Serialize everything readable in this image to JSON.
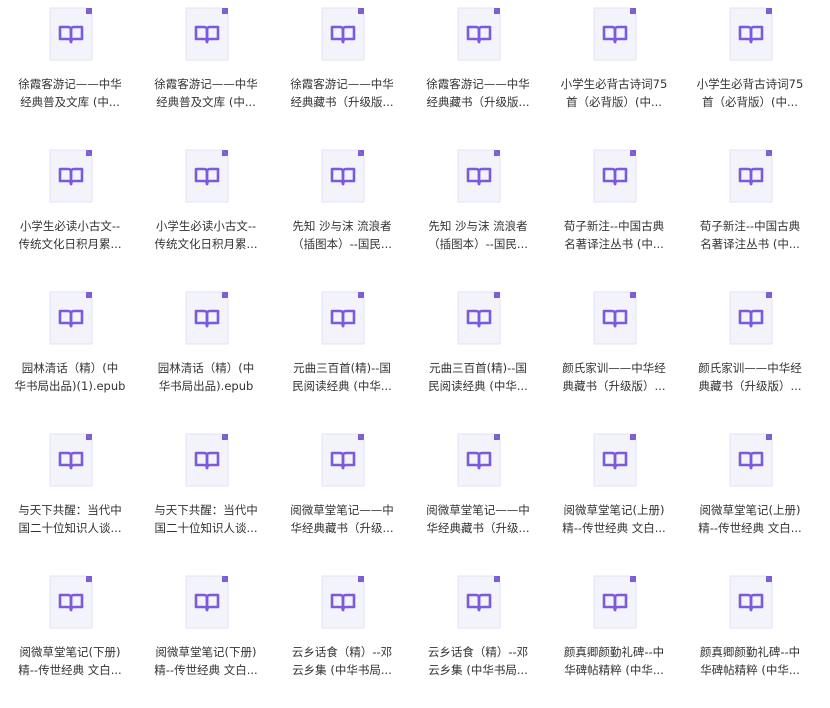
{
  "colors": {
    "page_bg": "#f3f3fb",
    "page_fold": "#ffffff",
    "accent": "#7b5bdc",
    "text": "#333333"
  },
  "icon_name": "book-file-icon",
  "files": [
    {
      "name": "徐霞客游记——中华\n经典普及文库 (中..."
    },
    {
      "name": "徐霞客游记——中华\n经典普及文库 (中..."
    },
    {
      "name": "徐霞客游记——中华\n经典藏书（升级版..."
    },
    {
      "name": "徐霞客游记——中华\n经典藏书（升级版..."
    },
    {
      "name": "小学生必背古诗词75\n首（必背版）(中..."
    },
    {
      "name": "小学生必背古诗词75\n首（必背版）(中..."
    },
    {
      "name": "小学生必读小古文--\n传统文化日积月累..."
    },
    {
      "name": "小学生必读小古文--\n传统文化日积月累..."
    },
    {
      "name": "先知 沙与沫 流浪者\n（插图本）--国民..."
    },
    {
      "name": "先知 沙与沫 流浪者\n（插图本）--国民..."
    },
    {
      "name": "荀子新注--中国古典\n名著译注丛书 (中..."
    },
    {
      "name": "荀子新注--中国古典\n名著译注丛书 (中..."
    },
    {
      "name": "园林清话（精）(中\n华书局出品)(1).epub"
    },
    {
      "name": "园林清话（精）(中\n华书局出品).epub"
    },
    {
      "name": "元曲三百首(精)--国\n民阅读经典 (中华..."
    },
    {
      "name": "元曲三百首(精)--国\n民阅读经典 (中华..."
    },
    {
      "name": "颜氏家训——中华经\n典藏书（升级版）..."
    },
    {
      "name": "颜氏家训——中华经\n典藏书（升级版）..."
    },
    {
      "name": "与天下共醒：当代中\n国二十位知识人谈..."
    },
    {
      "name": "与天下共醒：当代中\n国二十位知识人谈..."
    },
    {
      "name": "阅微草堂笔记——中\n华经典藏书（升级..."
    },
    {
      "name": "阅微草堂笔记——中\n华经典藏书（升级..."
    },
    {
      "name": "阅微草堂笔记(上册)\n精--传世经典 文白..."
    },
    {
      "name": "阅微草堂笔记(上册)\n精--传世经典 文白..."
    },
    {
      "name": "阅微草堂笔记(下册)\n精--传世经典 文白..."
    },
    {
      "name": "阅微草堂笔记(下册)\n精--传世经典 文白..."
    },
    {
      "name": "云乡话食（精）--邓\n云乡集 (中华书局..."
    },
    {
      "name": "云乡话食（精）--邓\n云乡集 (中华书局..."
    },
    {
      "name": "颜真卿颜勤礼碑--中\n华碑帖精粹 (中华..."
    },
    {
      "name": "颜真卿颜勤礼碑--中\n华碑帖精粹 (中华..."
    }
  ]
}
